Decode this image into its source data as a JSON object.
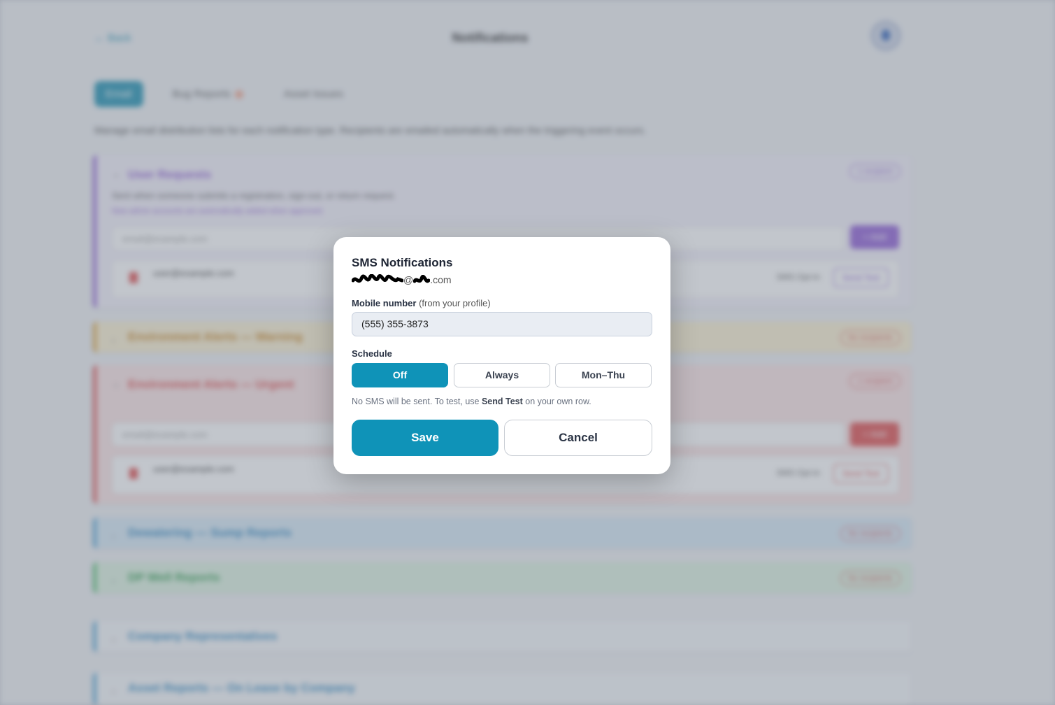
{
  "background": {
    "back_label": "← Back",
    "page_title": "Notifications",
    "tabs": [
      {
        "label": "Email"
      },
      {
        "label": "Bug Reports"
      },
      {
        "label": "Asset Issues"
      }
    ],
    "description": "Manage email distribution lists for each notification type. Recipients are emailed automatically when the triggering event occurs.",
    "sections": {
      "user_requests": {
        "title": "User Requests",
        "badge": "1 recipient",
        "subtitle": "Sent when someone submits a registration, sign-out, or return request.",
        "note": "New admin accounts are automatically added when approved.",
        "input_placeholder": "email@example.com",
        "add_label": "+ Add",
        "row_email": "user@example.com",
        "row_sms": "SMS Opt-In",
        "row_test": "Send Test"
      },
      "env_warning": {
        "title": "Environment Alerts — Warning",
        "badge": "No recipients"
      },
      "env_urgent": {
        "title": "Environment Alerts — Urgent",
        "badge": "1 recipient",
        "input_placeholder": "email@example.com",
        "add_label": "+ Add",
        "row_email": "user@example.com",
        "row_sms": "SMS Opt-In",
        "row_test": "Send Test"
      },
      "dewatering": {
        "title": "Dewatering — Sump Reports",
        "badge": "No recipients"
      },
      "dp_well": {
        "title": "DP Well Reports",
        "badge": "No recipients"
      },
      "company_reps": {
        "title": "Company Representatives"
      },
      "asset_reports": {
        "title": "Asset Reports — On Lease by Company"
      }
    }
  },
  "modal": {
    "title": "SMS Notifications",
    "email_visible": "@",
    "email_suffix": ".com",
    "mobile_label": "Mobile number",
    "mobile_hint": "(from your profile)",
    "mobile_value": "(555) 355-3873",
    "schedule_label": "Schedule",
    "schedule_options": [
      {
        "label": "Off",
        "selected": true
      },
      {
        "label": "Always",
        "selected": false
      },
      {
        "label": "Mon–Thu",
        "selected": false
      }
    ],
    "hint_prefix": "No SMS will be sent. To test, use ",
    "hint_bold": "Send Test",
    "hint_suffix": " on your own row.",
    "save_label": "Save",
    "cancel_label": "Cancel"
  },
  "colors": {
    "accent": "#0f93b8",
    "purple": "#8e5bd6",
    "red": "#e04a4a",
    "amber": "#e0a43a",
    "blue": "#4ca3d6",
    "green": "#4cbf6a"
  }
}
